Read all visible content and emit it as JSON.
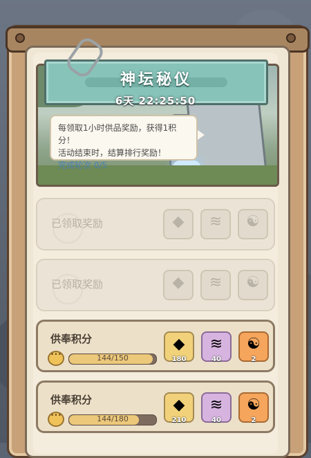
{
  "header": {
    "title": "神坛秘仪",
    "timer": "6天 22:25:50"
  },
  "info": {
    "line1": "每领取1小时供品奖励，获得1积分！",
    "line2": "活动结束时，结算排行奖励！",
    "progress_text": "完成轮次 0/5"
  },
  "rewards": [
    {
      "state": "claimed",
      "label": "已领取奖励",
      "items": [
        {
          "icon": "crystal-icon"
        },
        {
          "icon": "cannon-icon"
        },
        {
          "icon": "yin-yang-icon"
        }
      ]
    },
    {
      "state": "claimed",
      "label": "已领取奖励",
      "items": [
        {
          "icon": "crystal-icon"
        },
        {
          "icon": "cannon-icon"
        },
        {
          "icon": "yin-yang-icon"
        }
      ]
    },
    {
      "state": "active",
      "label": "供奉积分",
      "progress": "144/150",
      "progress_fraction": 0.96,
      "items": [
        {
          "icon": "crystal-icon",
          "count": "180"
        },
        {
          "icon": "cannon-icon",
          "count": "40"
        },
        {
          "icon": "yin-yang-icon",
          "count": "2"
        }
      ]
    },
    {
      "state": "active",
      "label": "供奉积分",
      "progress": "144/180",
      "progress_fraction": 0.8,
      "items": [
        {
          "icon": "crystal-icon",
          "count": "210"
        },
        {
          "icon": "cannon-icon",
          "count": "40"
        },
        {
          "icon": "yin-yang-icon",
          "count": "2"
        }
      ]
    }
  ],
  "colors": {
    "ribbon": "#87c3b9",
    "panel": "#efe6d4",
    "progress_fill": "#ecc87a"
  }
}
